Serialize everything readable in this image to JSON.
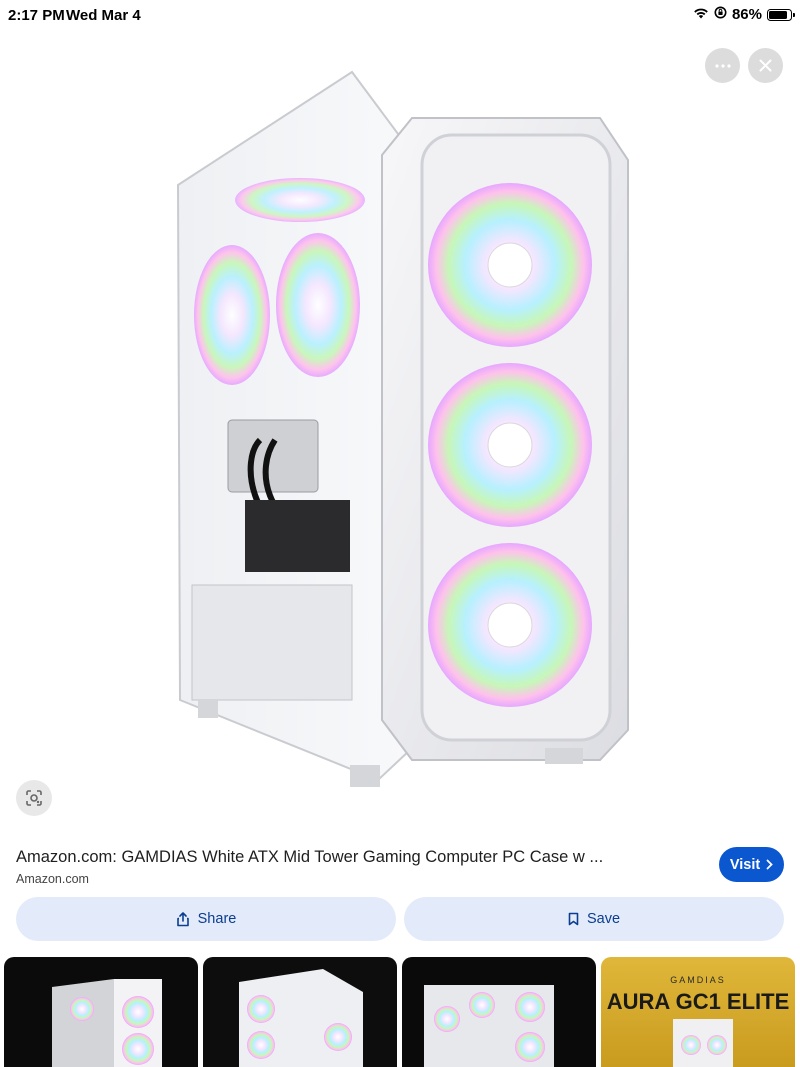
{
  "status_bar": {
    "time": "2:17 PM",
    "date": "Wed Mar 4",
    "battery_percent": "86%",
    "battery_level": 0.86,
    "icons": [
      "wifi-icon",
      "orientation-lock-icon",
      "battery-icon"
    ]
  },
  "viewer": {
    "more_icon": "more-horizontal-icon",
    "close_icon": "close-icon",
    "lens_icon": "lens-search-icon"
  },
  "result": {
    "title": "Amazon.com: GAMDIAS White ATX Mid Tower Gaming Computer PC Case w ...",
    "source": "Amazon.com",
    "visit_label": "Visit",
    "visit_icon": "chevron-right-icon",
    "accent_color": "#0b57d0"
  },
  "actions": {
    "share_label": "Share",
    "share_icon": "share-icon",
    "save_label": "Save",
    "save_icon": "bookmark-icon",
    "button_bg": "#e3ebfa"
  },
  "thumbnails": [
    {
      "icon": "pc-case-thumbnail"
    },
    {
      "icon": "pc-case-thumbnail"
    },
    {
      "icon": "pc-case-thumbnail"
    },
    {
      "brand": "",
      "subtitle": "GAMDIAS",
      "title": "AURA GC1 ELITE"
    }
  ]
}
